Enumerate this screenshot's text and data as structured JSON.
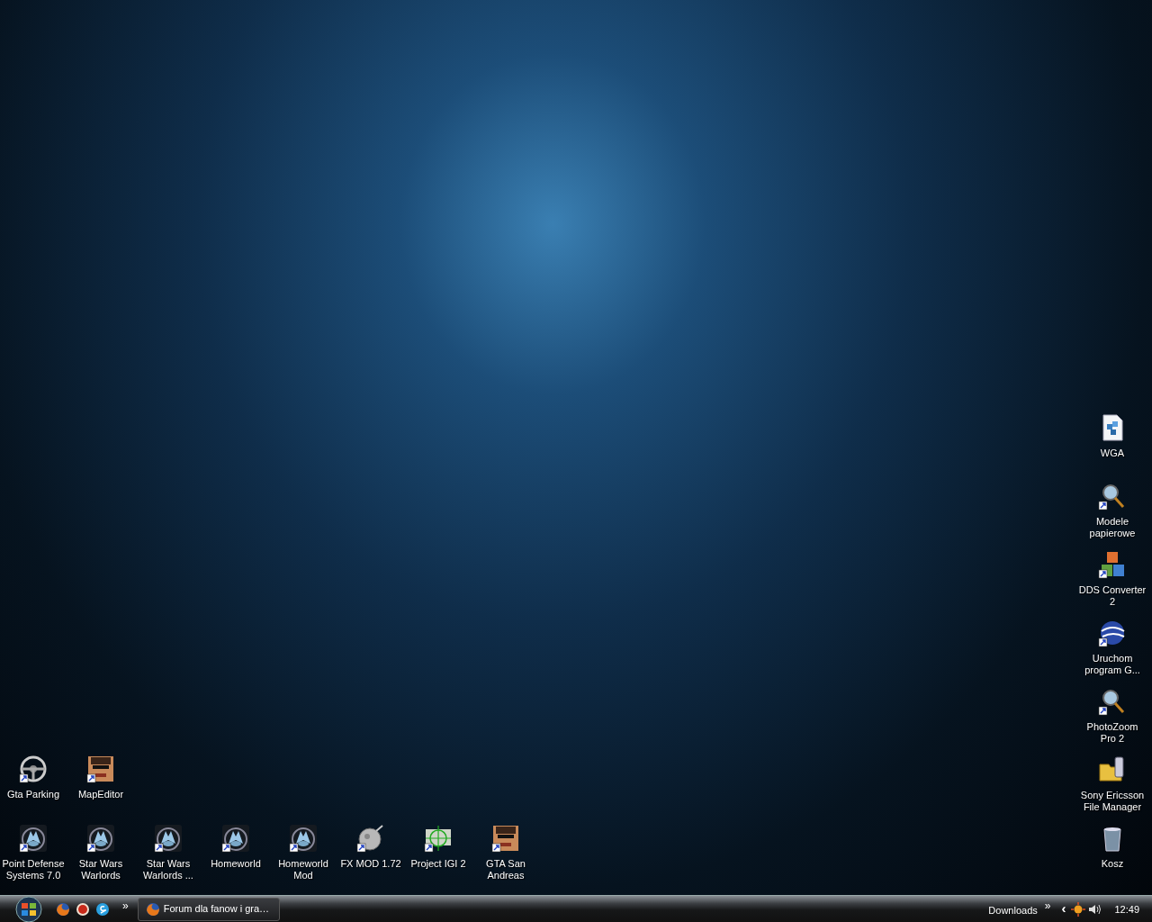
{
  "desktop": {
    "left_rows": [
      [
        {
          "label": "Gta Parking",
          "kind": "wheel",
          "shortcut": true
        },
        {
          "label": "MapEditor",
          "kind": "face",
          "shortcut": true
        }
      ],
      [
        {
          "label": "Point Defense Systems 7.0",
          "kind": "ship",
          "shortcut": true
        },
        {
          "label": "Star Wars Warlords",
          "kind": "ship",
          "shortcut": true
        },
        {
          "label": "Star Wars Warlords ...",
          "kind": "ship",
          "shortcut": true
        },
        {
          "label": "Homeworld",
          "kind": "ship",
          "shortcut": true
        },
        {
          "label": "Homeworld Mod",
          "kind": "ship",
          "shortcut": true
        },
        {
          "label": "FX MOD 1.72",
          "kind": "sphere",
          "shortcut": true
        },
        {
          "label": "Project IGI 2",
          "kind": "target",
          "shortcut": true
        },
        {
          "label": "GTA San Andreas",
          "kind": "face",
          "shortcut": true
        }
      ]
    ],
    "right_column": [
      {
        "label": "WGA",
        "kind": "document",
        "shortcut": false
      },
      {
        "label": "Modele papierowe",
        "kind": "magnifier",
        "shortcut": true
      },
      {
        "label": "DDS Converter 2",
        "kind": "cubes",
        "shortcut": true
      },
      {
        "label": "Uruchom program G...",
        "kind": "globe",
        "shortcut": true
      },
      {
        "label": "PhotoZoom Pro 2",
        "kind": "magnifier",
        "shortcut": true
      },
      {
        "label": "Sony Ericsson File Manager",
        "kind": "folder",
        "shortcut": false
      },
      {
        "label": "Kosz",
        "kind": "trash",
        "shortcut": false
      }
    ]
  },
  "taskbar": {
    "quick_launch": [
      {
        "kind": "browser"
      },
      {
        "kind": "red"
      },
      {
        "kind": "chat"
      }
    ],
    "quick_launch_more": "»",
    "tasks": [
      {
        "label": "Forum dla fanow i gra…",
        "selected": false
      }
    ],
    "toolbar_label": "Downloads",
    "toolbar_more": "»",
    "tray_expand": "‹",
    "clock": "12:49"
  }
}
